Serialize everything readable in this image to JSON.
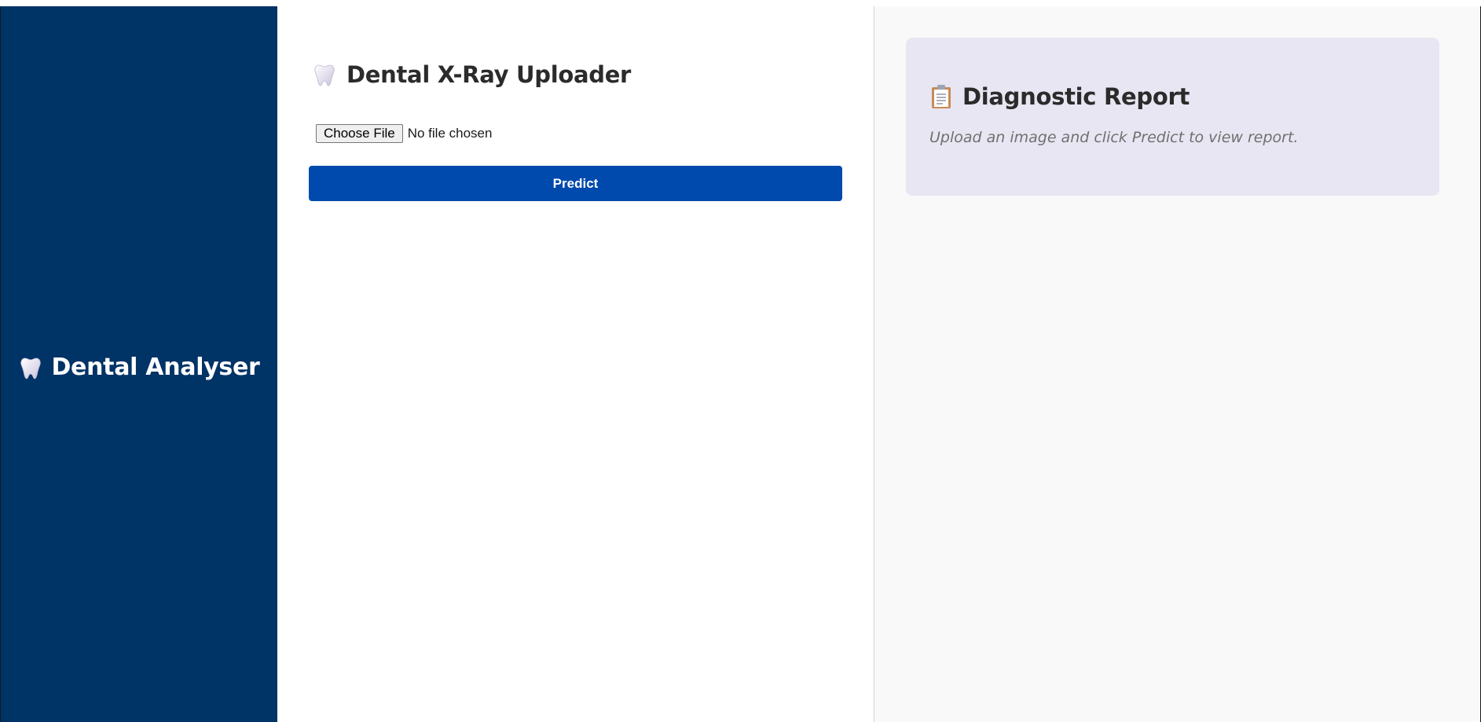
{
  "sidebar": {
    "brand_title": "Dental Analyser",
    "brand_icon": "tooth-icon"
  },
  "uploader": {
    "title": "Dental X-Ray Uploader",
    "title_icon": "tooth-icon",
    "choose_file_label": "Choose File",
    "file_status": "No file chosen",
    "predict_label": "Predict"
  },
  "report": {
    "title": "Diagnostic Report",
    "title_icon": "clipboard-icon",
    "placeholder": "Upload an image and click Predict to view report."
  },
  "colors": {
    "sidebar_bg": "#003366",
    "predict_button": "#004aad",
    "report_card_bg": "#e8e6f2",
    "report_pane_bg": "#f9f9f9"
  }
}
